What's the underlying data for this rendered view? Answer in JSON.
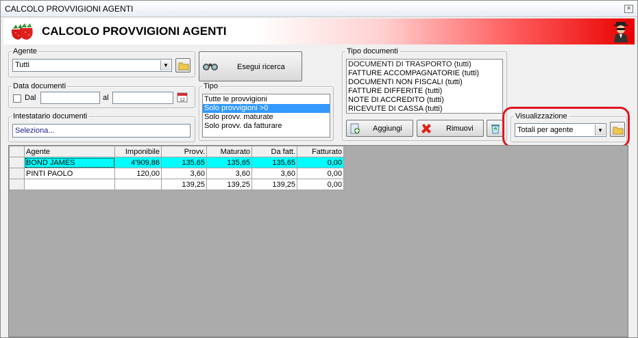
{
  "window": {
    "title": "CALCOLO PROVVIGIONI AGENTI",
    "close_glyph": "×"
  },
  "banner": {
    "title": "CALCOLO PROVVIGIONI AGENTI"
  },
  "agente": {
    "legend": "Agente",
    "value": "Tutti"
  },
  "search": {
    "label": "Esegui ricerca"
  },
  "data_documenti": {
    "legend": "Data documenti",
    "dal_label": "Dal",
    "al_label": "al",
    "dal_value": "",
    "al_value": ""
  },
  "intestatario": {
    "legend": "Intestatario documenti",
    "value": "Seleziona..."
  },
  "tipo": {
    "legend": "Tipo",
    "items": [
      "Tutte le provvigioni",
      "Solo provvigioni >0",
      "Solo provv. maturate",
      "Solo provv. da fatturare"
    ],
    "selected_index": 1
  },
  "tipo_documenti": {
    "legend": "Tipo documenti",
    "items": [
      "DOCUMENTI DI TRASPORTO (tutti)",
      "FATTURE ACCOMPAGNATORIE (tutti)",
      "DOCUMENTI NON FISCALI (tutti)",
      "FATTURE DIFFERITE (tutti)",
      "NOTE DI ACCREDITO (tutti)",
      "RICEVUTE DI CASSA (tutti)"
    ],
    "add_label": "Aggiungi",
    "remove_label": "Rimuovi"
  },
  "visualizzazione": {
    "legend": "Visualizzazione",
    "value": "Totali per agente"
  },
  "grid": {
    "columns": [
      "Agente",
      "Imponibile",
      "Provv.",
      "Maturato",
      "Da fatt.",
      "Fatturato"
    ],
    "rows": [
      [
        "BOND JAMES",
        "4'909,86",
        "135,65",
        "135,65",
        "135,65",
        "0,00"
      ],
      [
        "PINTI PAOLO",
        "120,00",
        "3,60",
        "3,60",
        "3,60",
        "0,00"
      ],
      [
        "",
        "",
        "139,25",
        "139,25",
        "139,25",
        "0,00"
      ]
    ],
    "highlight_color": "#00ffff"
  },
  "colors": {
    "selection": "#3399ff",
    "annotation_ring": "#e0141e",
    "banner_red": "#e80000"
  }
}
